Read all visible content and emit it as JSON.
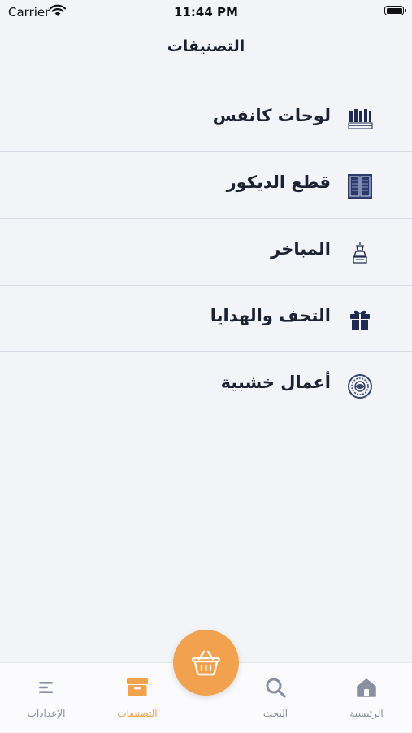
{
  "status_bar": {
    "carrier": "Carrier",
    "time": "11:44 PM"
  },
  "header": {
    "title": "التصنيفات"
  },
  "categories": [
    {
      "label": "لوحات كانفس",
      "icon": "canvas-panels-icon"
    },
    {
      "label": "قطع الديكور",
      "icon": "decor-pieces-icon"
    },
    {
      "label": "المباخر",
      "icon": "incense-burner-icon"
    },
    {
      "label": "التحف والهدايا",
      "icon": "gift-icon"
    },
    {
      "label": "أعمال خشبية",
      "icon": "woodwork-ornament-icon"
    }
  ],
  "tab_bar": {
    "items": [
      {
        "label": "الإعدادات",
        "icon": "menu-lines-icon",
        "active": false
      },
      {
        "label": "التصنيفات",
        "icon": "archive-box-icon",
        "active": true
      },
      {
        "label": "البحث",
        "icon": "search-icon",
        "active": false
      },
      {
        "label": "الرئيسية",
        "icon": "home-icon",
        "active": false
      }
    ],
    "center_button": {
      "icon": "basket-icon"
    }
  },
  "colors": {
    "accent": "#f2a24f",
    "icon_navy": "#1f2a52",
    "background": "#f2f4f8",
    "inactive_tab": "#8a90a2"
  }
}
